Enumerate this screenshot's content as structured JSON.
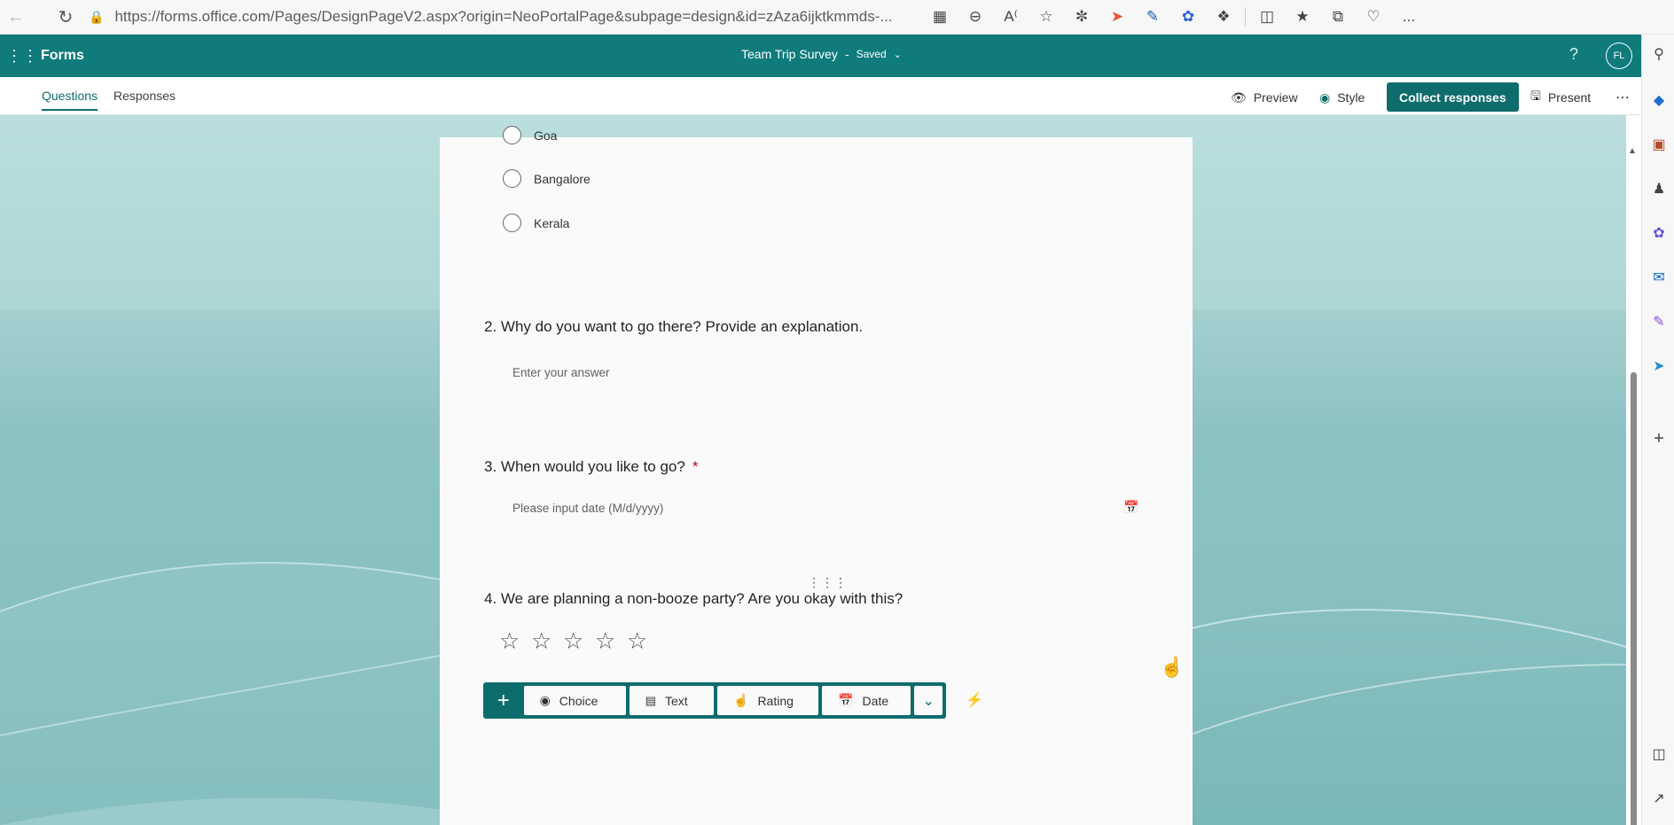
{
  "browser": {
    "url": "https://forms.office.com/Pages/DesignPageV2.aspx?origin=NeoPortalPage&subpage=design&id=zAza6ijktkmmds-...",
    "icons": [
      "back-icon",
      "refresh-icon",
      "lock-icon",
      "app-available-icon",
      "zoom-out-icon",
      "read-aloud-icon",
      "favorite-icon",
      "extension-icons",
      "split-screen-icon",
      "favorites-icon",
      "collections-icon",
      "health-icon",
      "more-icon"
    ],
    "more": "..."
  },
  "header": {
    "app_name": "Forms",
    "form_title": "Team Trip Survey",
    "separator": "-",
    "status": "Saved",
    "help": "?",
    "avatar_initials": "FL"
  },
  "commandbar": {
    "tab_questions": "Questions",
    "tab_responses": "Responses",
    "preview": "Preview",
    "style": "Style",
    "collect": "Collect responses",
    "present": "Present",
    "more": "⋯"
  },
  "form": {
    "q1_options": [
      "Goa",
      "Bangalore",
      "Kerala"
    ],
    "q2": {
      "title": "2. Why do you want to go there? Provide an explanation.",
      "placeholder": "Enter your answer"
    },
    "q3": {
      "title": "3. When would you like to go?",
      "required_mark": "*",
      "placeholder": "Please input date (M/d/yyyy)"
    },
    "q4": {
      "title": "4. We are planning a non-booze party? Are you okay with this?",
      "rating_max": 5,
      "rating_value": 0
    }
  },
  "add_toolbar": {
    "plus": "+",
    "choice": "Choice",
    "text": "Text",
    "rating": "Rating",
    "date": "Date"
  },
  "colors": {
    "brand": "#0f7b7b",
    "accent_dark": "#0f6c6c",
    "required": "#b10e1c"
  }
}
